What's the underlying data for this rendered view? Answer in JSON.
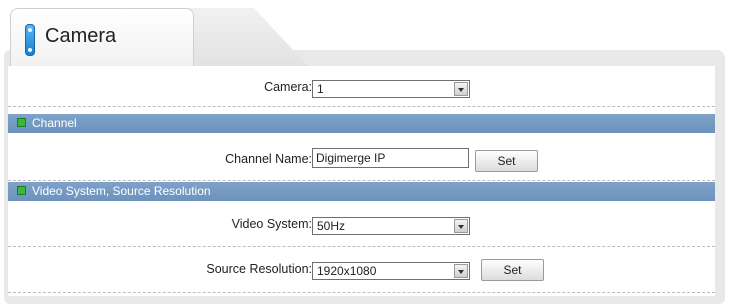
{
  "tab": {
    "label": "Camera"
  },
  "camera_row": {
    "label": "Camera:",
    "value": "1"
  },
  "channel_section": {
    "title": "Channel"
  },
  "channel_name_row": {
    "label": "Channel Name:",
    "value": "Digimerge IP",
    "set_label": "Set"
  },
  "video_section": {
    "title": "Video System, Source Resolution"
  },
  "video_system_row": {
    "label": "Video System:",
    "value": "50Hz"
  },
  "source_resolution_row": {
    "label": "Source Resolution:",
    "value": "1920x1080",
    "set_label": "Set"
  },
  "colors": {
    "section_bar": "#7fa2c8",
    "section_icon": "#38b93a",
    "tab_icon": "#2a93e0"
  },
  "icons": {
    "tab": "camera-tab-icon",
    "section": "green-square-icon",
    "dropdown": "chevron-down-icon"
  }
}
